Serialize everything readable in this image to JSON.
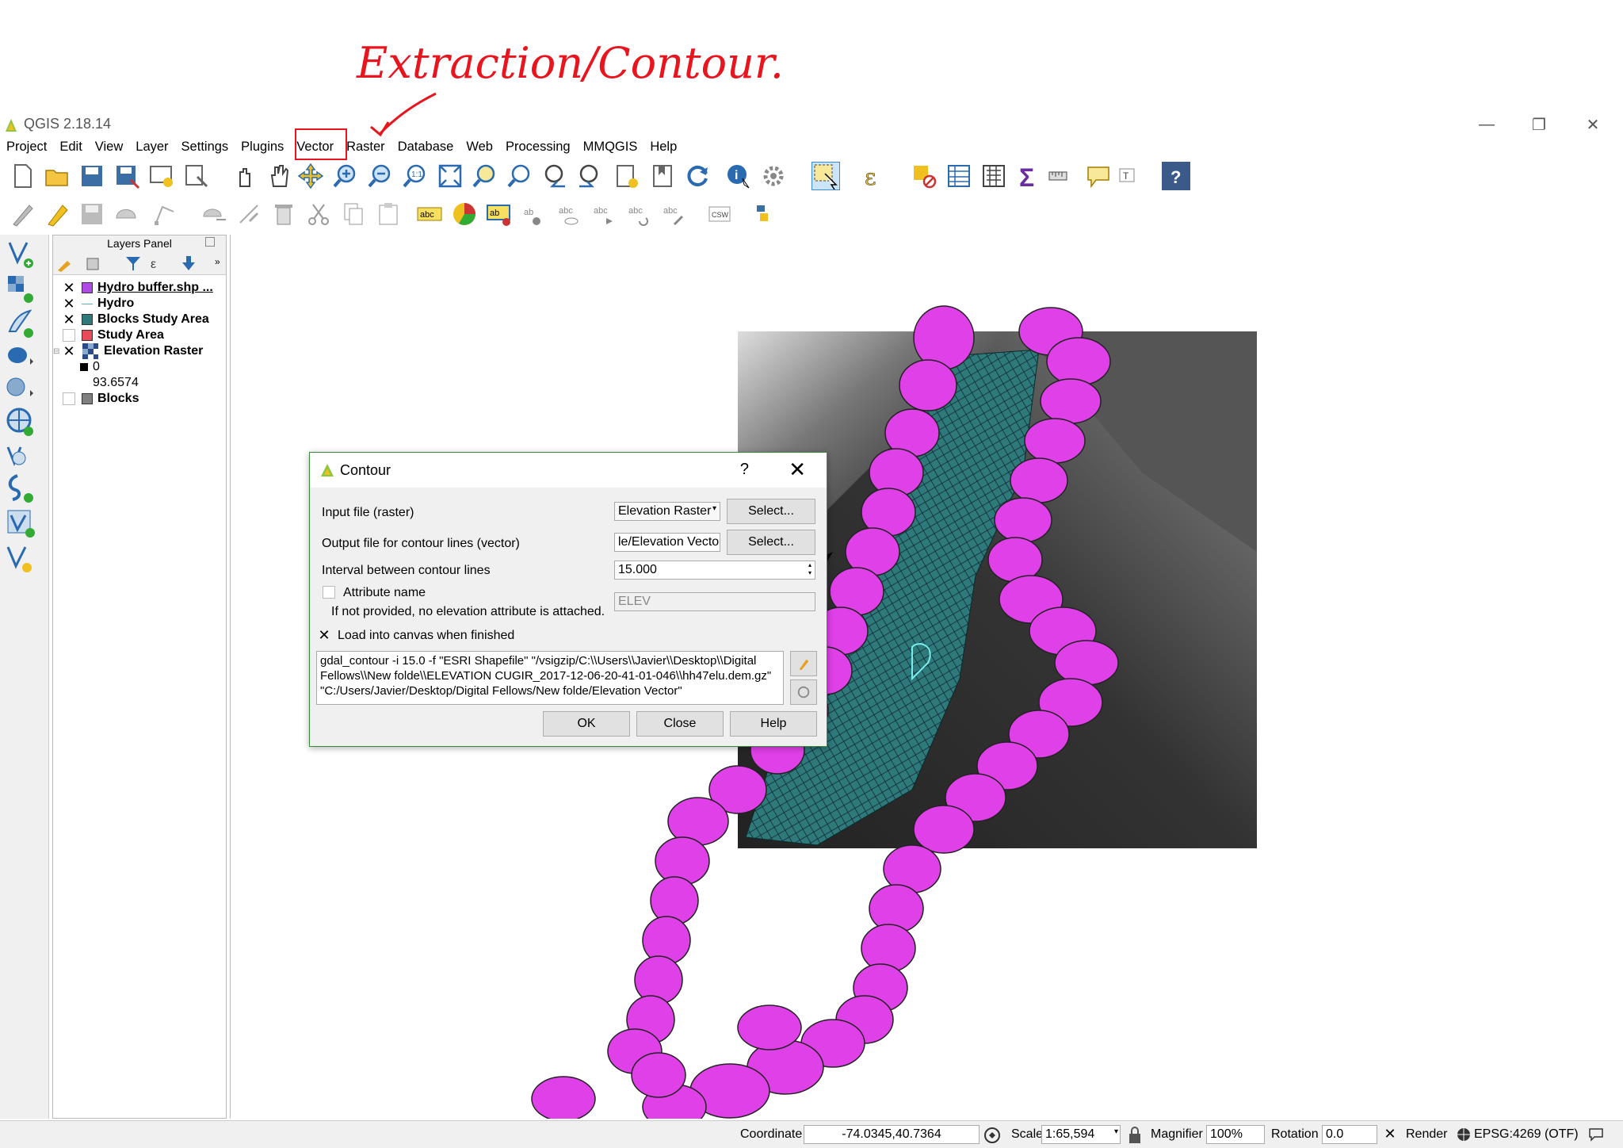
{
  "annotation": {
    "text": "Extraction/Contour...",
    "color": "#e8141e"
  },
  "window": {
    "title": "QGIS 2.18.14",
    "minimize": "—",
    "restore": "❐",
    "close": "✕"
  },
  "menubar": [
    "Project",
    "Edit",
    "View",
    "Layer",
    "Settings",
    "Plugins",
    "Vector",
    "Raster",
    "Database",
    "Web",
    "Processing",
    "MMQGIS",
    "Help"
  ],
  "layers_panel": {
    "title": "Layers Panel",
    "layers": [
      {
        "name": "Hydro buffer.shp ...",
        "checked": true,
        "swatch": "#b04ae6",
        "bold": true,
        "underline": true
      },
      {
        "name": "Hydro",
        "checked": true,
        "swatch": "line",
        "bold": true
      },
      {
        "name": "Blocks Study Area",
        "checked": true,
        "swatch": "#2e7a7a",
        "bold": true
      },
      {
        "name": "Study Area",
        "checked": false,
        "swatch": "#e84a5a",
        "bold": true
      },
      {
        "name": "Elevation Raster",
        "checked": true,
        "swatch": "raster",
        "bold": true
      },
      {
        "name": "0",
        "legend": true
      },
      {
        "name": "93.6574",
        "legend": true
      },
      {
        "name": "Blocks",
        "checked": false,
        "swatch": "#808080",
        "bold": true
      }
    ]
  },
  "dialog": {
    "title": "Contour",
    "help_symbol": "?",
    "close_symbol": "✕",
    "input_label": "Input file (raster)",
    "input_value": "Elevation Raster",
    "output_label": "Output file for contour lines (vector)",
    "output_value": "le/Elevation Vector",
    "select_label": "Select...",
    "interval_label": "Interval between contour lines",
    "interval_value": "15.000",
    "attribute_label": "Attribute name",
    "attribute_placeholder": "ELEV",
    "attribute_hint": "If not provided, no elevation attribute is attached.",
    "load_label": "Load into canvas when finished",
    "command_lines": [
      "gdal_contour -i 15.0 -f \"ESRI Shapefile\" \"/vsigzip/C:\\\\Users\\\\Javier\\\\Desktop\\\\Digital",
      "Fellows\\\\New folde\\\\ELEVATION CUGIR_2017-12-06-20-41-01-046\\\\hh47elu.dem.gz\"",
      "\"C:/Users/Javier/Desktop/Digital Fellows/New folde/Elevation Vector\""
    ],
    "ok": "OK",
    "close": "Close",
    "help": "Help"
  },
  "statusbar": {
    "coordinate_label": "Coordinate",
    "coordinate_value": "-74.0345,40.7364",
    "scale_label": "Scale",
    "scale_value": "1:65,594",
    "magnifier_label": "Magnifier",
    "magnifier_value": "100%",
    "rotation_label": "Rotation",
    "rotation_value": "0.0",
    "render_label": "Render",
    "crs": "EPSG:4269 (OTF)"
  },
  "colors": {
    "buffer": "#e040e8",
    "blocks": "#2e7a7a",
    "dialog_border": "#3a8a3a"
  }
}
